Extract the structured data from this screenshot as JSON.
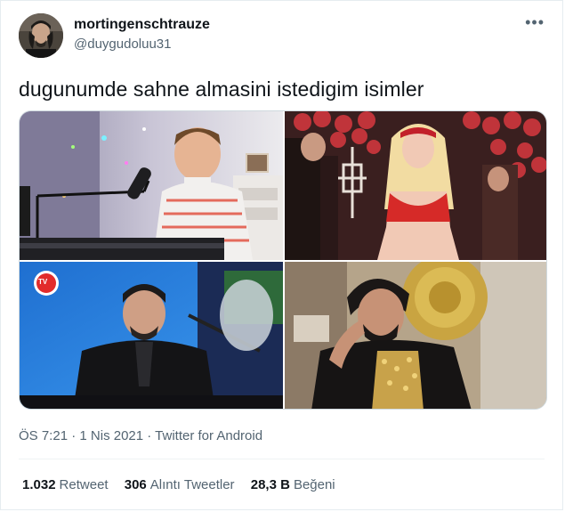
{
  "user": {
    "display_name": "mortingenschtrauze",
    "handle": "@duygudoluu31"
  },
  "more_icon": "more-dots-icon",
  "tweet": {
    "text": "dugunumde sahne almasini istedigim isimler"
  },
  "media": {
    "images": [
      {
        "name": "photo-boy-keyboard"
      },
      {
        "name": "photo-woman-red-dress"
      },
      {
        "name": "photo-man-keyboard-tv"
      },
      {
        "name": "photo-man-gold-throne"
      }
    ],
    "tv_logo": "TV"
  },
  "meta": {
    "time": "ÖS 7:21",
    "sep1": " · ",
    "date": "1 Nis 2021",
    "sep2": " · ",
    "source": "Twitter for Android"
  },
  "stats": {
    "retweets_count": "1.032",
    "retweets_label": "Retweet",
    "quotes_count": "306",
    "quotes_label": "Alıntı Tweetler",
    "likes_count": "28,3 B",
    "likes_label": "Beğeni"
  }
}
